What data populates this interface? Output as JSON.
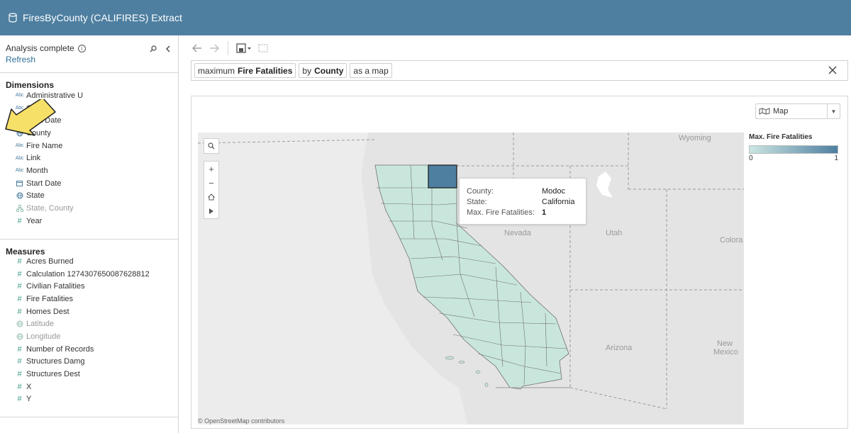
{
  "app": {
    "title": "FiresByCounty (CALIFIRES) Extract"
  },
  "panel": {
    "status": "Analysis complete",
    "refresh": "Refresh"
  },
  "dimensions": {
    "title": "Dimensions",
    "fields": [
      {
        "name": "Administrative U",
        "type": "abc"
      },
      {
        "name": "Cause",
        "type": "abc"
      },
      {
        "name": "Cont Date",
        "type": "date"
      },
      {
        "name": "County",
        "type": "geo"
      },
      {
        "name": "Fire Name",
        "type": "abc"
      },
      {
        "name": "Link",
        "type": "abc"
      },
      {
        "name": "Month",
        "type": "abc"
      },
      {
        "name": "Start Date",
        "type": "date"
      },
      {
        "name": "State",
        "type": "geo"
      },
      {
        "name": "State, County",
        "type": "hierarchy"
      },
      {
        "name": "Year",
        "type": "number"
      }
    ]
  },
  "measures": {
    "title": "Measures",
    "fields": [
      {
        "name": "Acres Burned",
        "type": "number"
      },
      {
        "name": "Calculation 1274307650087628812",
        "type": "number"
      },
      {
        "name": "Civilian Fatalities",
        "type": "number"
      },
      {
        "name": "Fire Fatalities",
        "type": "number"
      },
      {
        "name": "Homes Dest",
        "type": "number"
      },
      {
        "name": "Latitude",
        "type": "geo-muted"
      },
      {
        "name": "Longitude",
        "type": "geo-muted"
      },
      {
        "name": "Number of Records",
        "type": "number"
      },
      {
        "name": "Structures Damg",
        "type": "number"
      },
      {
        "name": "Structures Dest",
        "type": "number"
      },
      {
        "name": "X",
        "type": "number"
      },
      {
        "name": "Y",
        "type": "number"
      }
    ]
  },
  "query": {
    "pill1_prefix": "maximum",
    "pill1_bold": "Fire Fatalities",
    "pill2_prefix": "by",
    "pill2_bold": "County",
    "pill3": "as a map"
  },
  "viz": {
    "type_selected": "Map",
    "map_labels": {
      "wyoming": "Wyoming",
      "nevada": "Nevada",
      "utah": "Utah",
      "colorado": "Colora",
      "arizona": "Arizona",
      "new": "New",
      "mexico": "Mexico"
    },
    "attribution": "© OpenStreetMap contributors",
    "tooltip": {
      "county_label": "County:",
      "county_value": "Modoc",
      "state_label": "State:",
      "state_value": "California",
      "metric_label": "Max. Fire Fatalities:",
      "metric_value": "1"
    },
    "legend": {
      "title": "Max. Fire Fatalities",
      "min": "0",
      "max": "1",
      "color_low": "#cbe6e2",
      "color_high": "#4e7fa1"
    }
  },
  "colors": {
    "header": "#4e7fa1",
    "link": "#2f6f96",
    "highlight_arrow": "#f7e067"
  }
}
